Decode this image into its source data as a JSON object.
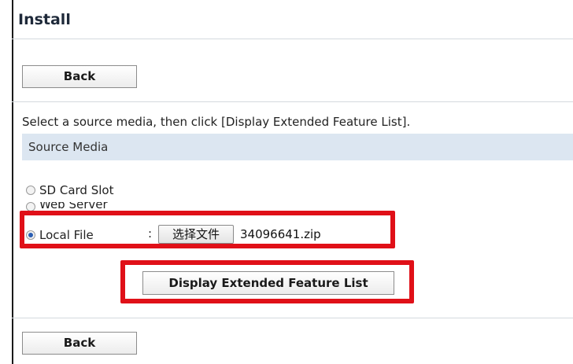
{
  "page": {
    "title": "Install",
    "back_label": "Back",
    "instruction": "Select a source media, then click [Display Extended Feature List]."
  },
  "source_media": {
    "header": "Source Media",
    "options": [
      {
        "label": "SD Card Slot",
        "selected": false
      },
      {
        "label": "Web Server",
        "selected": false
      },
      {
        "label": "Local File",
        "selected": true
      }
    ],
    "separator": ":",
    "file_button_label": "选择文件",
    "file_name": "34096641.zip"
  },
  "actions": {
    "display_label": "Display Extended Feature List"
  },
  "colors": {
    "section_bg": "#dce6f1",
    "highlight": "#e01018"
  }
}
